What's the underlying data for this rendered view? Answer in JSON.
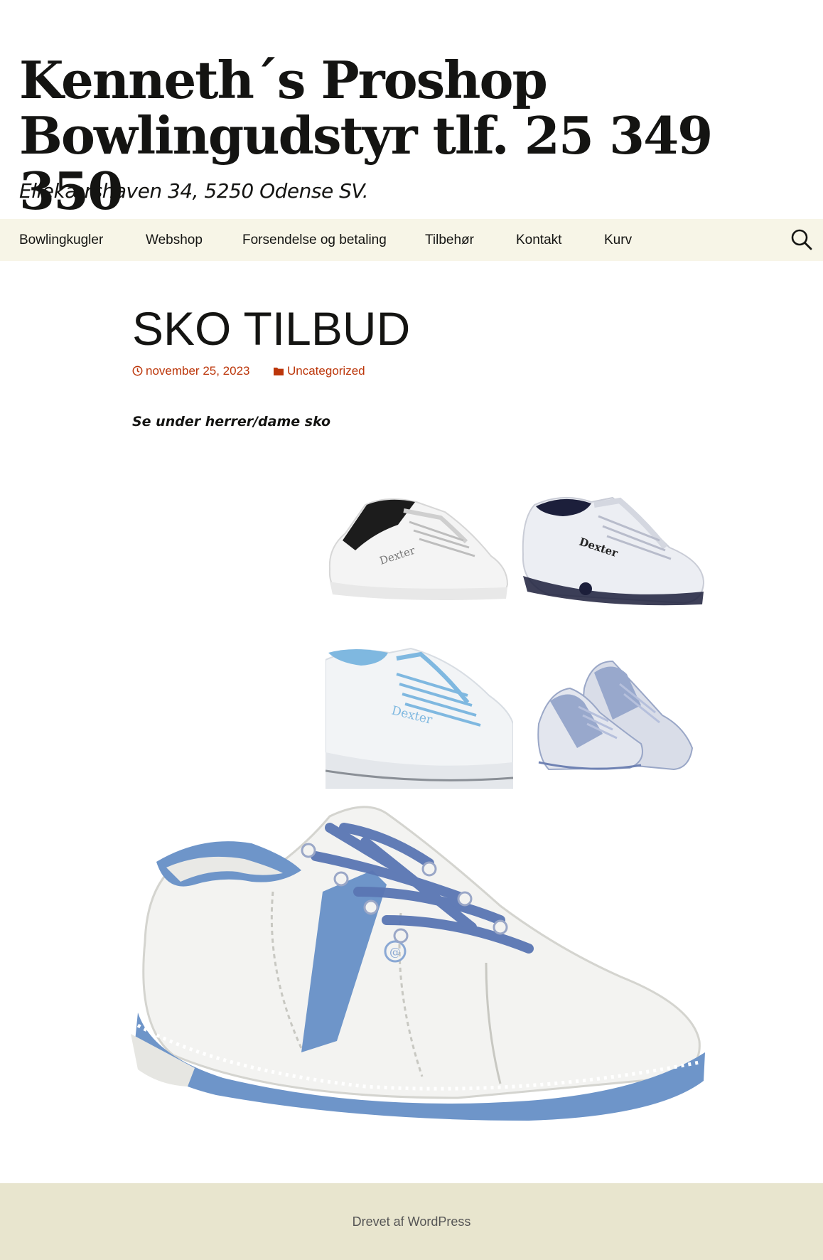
{
  "header": {
    "title_line1": "Kenneth´s Proshop",
    "title_line2": "Bowlingudstyr tlf. 25 349 350",
    "description": "Ellekærshaven 34, 5250 Odense SV."
  },
  "nav": {
    "items": [
      {
        "label": "Bowlingkugler"
      },
      {
        "label": "Webshop"
      },
      {
        "label": "Forsendelse og betaling"
      },
      {
        "label": "Tilbehør"
      },
      {
        "label": "Kontakt"
      },
      {
        "label": "Kurv"
      }
    ],
    "search_icon": "search-icon"
  },
  "post": {
    "title": "SKO TILBUD",
    "date": "november 25, 2023",
    "category": "Uncategorized",
    "lead": "Se under herrer/dame sko",
    "images": [
      {
        "name": "shoe-black-white",
        "colors": [
          "#ffffff",
          "#1a1a1a"
        ]
      },
      {
        "name": "shoe-white-navy",
        "colors": [
          "#f1f1f5",
          "#1c1f3b"
        ]
      },
      {
        "name": "shoe-white-lightblue",
        "colors": [
          "#ffffff",
          "#7fb8e0"
        ]
      },
      {
        "name": "shoe-grey-blue-pair",
        "colors": [
          "#cfd6e6",
          "#8fa0c6"
        ]
      },
      {
        "name": "shoe-white-blue-large",
        "colors": [
          "#f4f4f2",
          "#6e95c9"
        ]
      }
    ]
  },
  "footer": {
    "credit": "Drevet af WordPress"
  },
  "colors": {
    "nav_bg": "#f7f5e7",
    "footer_bg": "#e8e5ce",
    "accent": "#bc360a"
  }
}
